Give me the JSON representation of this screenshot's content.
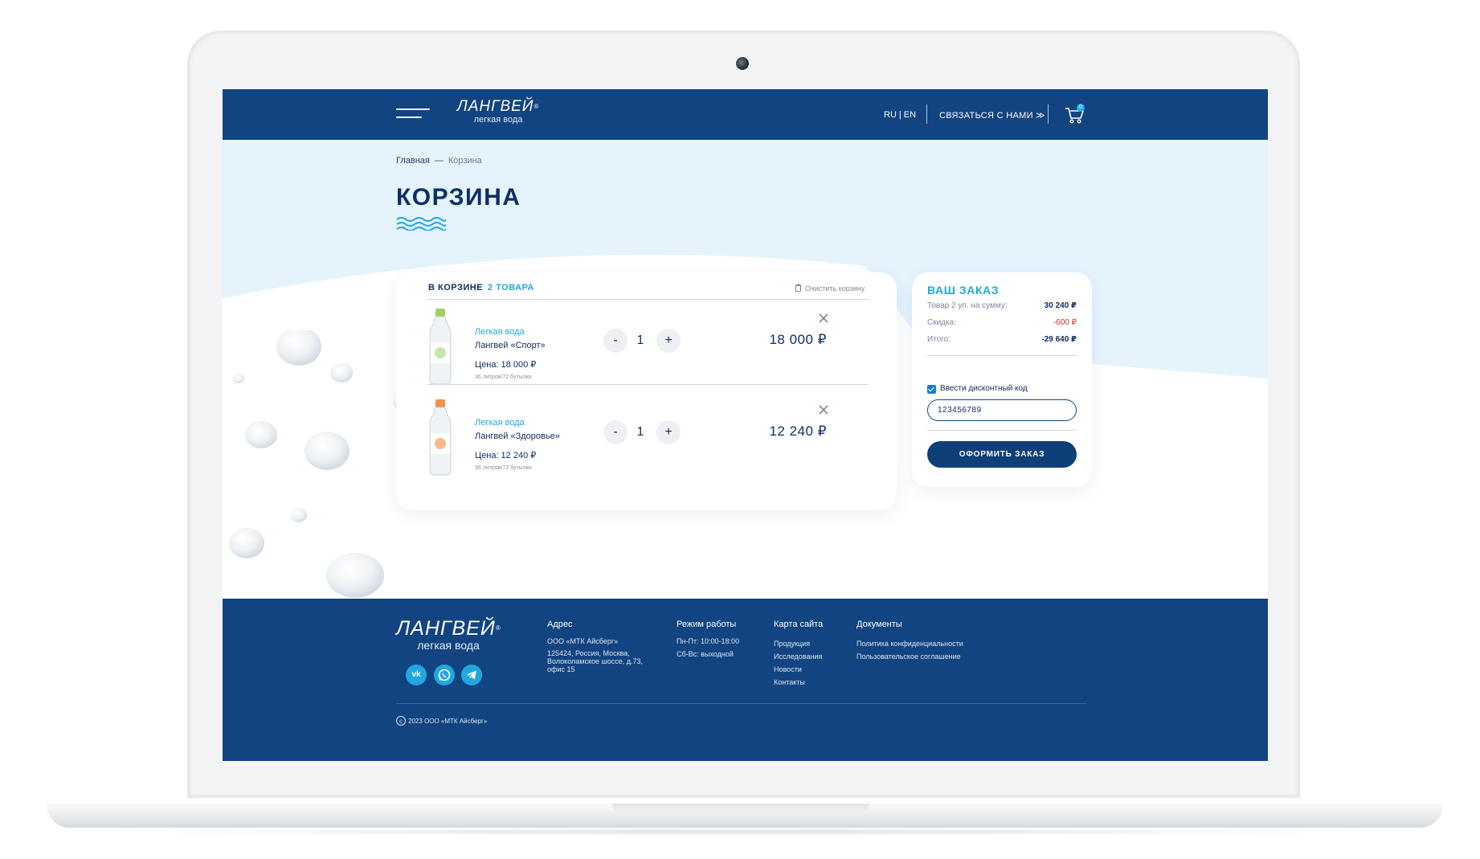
{
  "header": {
    "logo_brand": "ЛАНГВЕЙ",
    "logo_reg": "®",
    "logo_sub": "легкая вода",
    "lang_ru": "RU",
    "lang_sep": "|",
    "lang_en": "EN",
    "contact_label": "СВЯЗАТЬСЯ С НАМИ ≫",
    "cart_count": "0"
  },
  "breadcrumb": {
    "home": "Главная",
    "dash": "—",
    "current": "Корзина"
  },
  "page_title": "КОРЗИНА",
  "cart": {
    "heading": "В КОРЗИНЕ",
    "count_label": "2 ТОВАРА",
    "clear_label": "Очистить корзину",
    "items": [
      {
        "brand": "Легкая вода",
        "name": "Лангвей «Спорт»",
        "price": "Цена: 18 000 ₽",
        "note": "36 литров/72 бутылки",
        "qty": "1",
        "minus": "-",
        "plus": "+",
        "total": "18 000 ₽",
        "cap_color": "#9bd06a"
      },
      {
        "brand": "Легкая вода",
        "name": "Лангвей «Здоровье»",
        "price": "Цена: 12 240 ₽",
        "note": "36 литров/72 бутылки",
        "qty": "1",
        "minus": "-",
        "plus": "+",
        "total": "12 240 ₽",
        "cap_color": "#f2924b"
      }
    ]
  },
  "order": {
    "title": "ВАШ ЗАКАЗ",
    "rows": [
      {
        "label": "Товар 2 уп. на сумму:",
        "value": "30 240 ₽"
      },
      {
        "label": "Скидка:",
        "value": "-600 ₽"
      },
      {
        "label": "Итого:",
        "value": "-29 640 ₽"
      }
    ],
    "discount_checkbox_label": "Ввести дисконтный код",
    "discount_value": "123456789",
    "submit_label": "ОФОРМИТЬ ЗАКАЗ"
  },
  "footer": {
    "logo_brand": "ЛАНГВЕЙ",
    "logo_reg": "®",
    "logo_sub": "легкая вода",
    "social": [
      "vk-icon",
      "whatsapp-icon",
      "telegram-icon"
    ],
    "address": {
      "heading": "Адрес",
      "company": "ООО «МТК Айсберг»",
      "line1": "125424, Россия, Москва,",
      "line2": "Волоколамское шоссе, д.73,",
      "line3": "офис 15"
    },
    "hours": {
      "heading": "Режим работы",
      "weekdays": "Пн-Пт: 10:00-18:00",
      "weekend": "Сб-Вс: выходной"
    },
    "sitemap": {
      "heading": "Карта сайта",
      "links": [
        "Продукция",
        "Исследования",
        "Новости",
        "Контакты"
      ]
    },
    "documents": {
      "heading": "Документы",
      "links": [
        "Политика конфиденциальности",
        "Пользовательское соглашение"
      ]
    },
    "copyright": "2023 ООО «МТК Айсберг»"
  },
  "colors": {
    "brand_blue": "#114480",
    "accent_cyan": "#21a7df",
    "discount_red": "#e0262b",
    "hero_bg": "#e5f3fd"
  }
}
